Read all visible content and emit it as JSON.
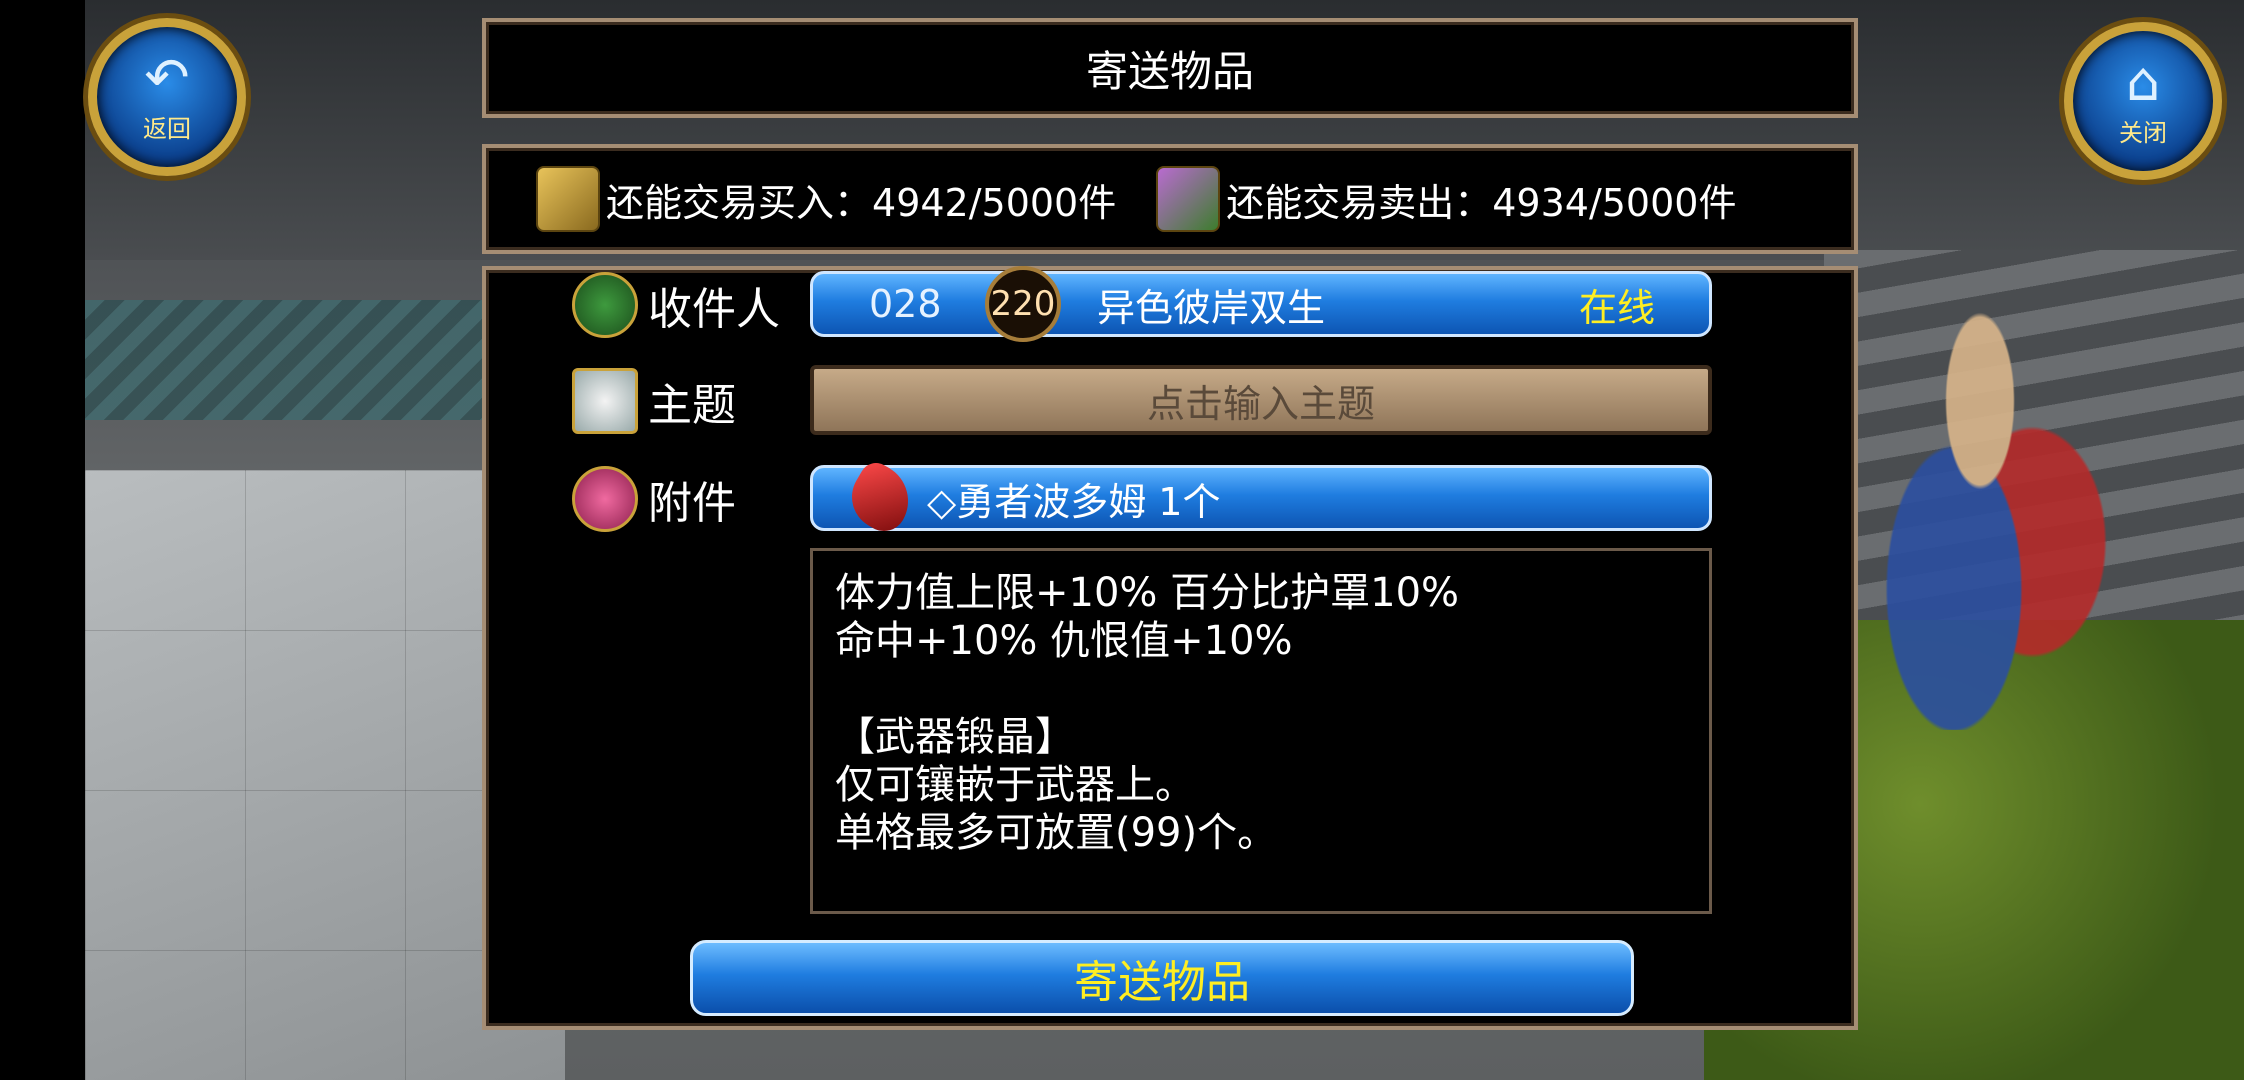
{
  "nav": {
    "back_label": "返回",
    "close_label": "关闭",
    "back_icon": "back-arrow-icon",
    "close_icon": "home-icon"
  },
  "dialog": {
    "title": "寄送物品",
    "quota": {
      "buy_label": "还能交易买入：",
      "buy_value": "4942/5000件",
      "sell_label": "还能交易卖出：",
      "sell_value": "4934/5000件"
    },
    "recipient": {
      "label": "收件人",
      "id": "028",
      "level": "220",
      "name": "异色彼岸双生",
      "status": "在线"
    },
    "subject": {
      "label": "主题",
      "placeholder": "点击输入主题"
    },
    "attachment": {
      "label": "附件",
      "item": "◇勇者波多姆 1个"
    },
    "description": "体力值上限+10% 百分比护罩10%\n命中+10% 仇恨值+10%\n\n【武器锻晶】\n仅可镶嵌于武器上。\n单格最多可放置(99)个。",
    "send_button": "寄送物品"
  },
  "colors": {
    "accent_blue": "#1f7de0",
    "highlight_yellow": "#ffee22",
    "frame": "#a58d74"
  }
}
